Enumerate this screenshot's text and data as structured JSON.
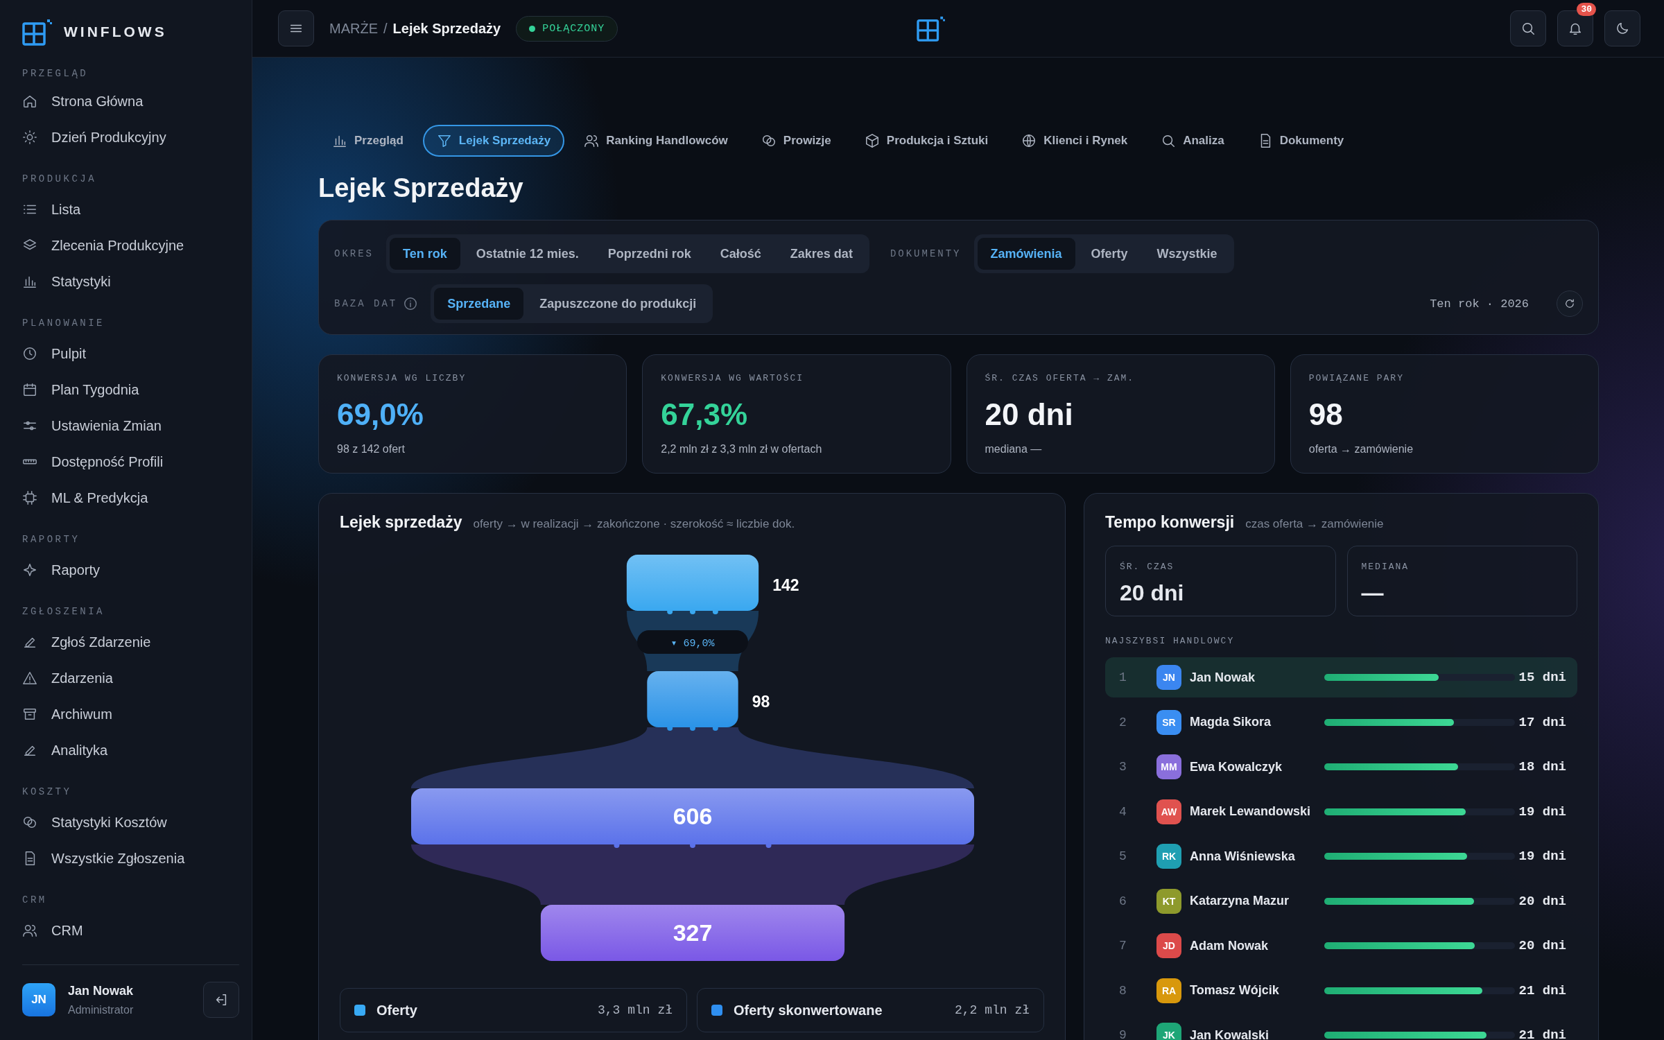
{
  "sidebar": {
    "brand": "WINFLOWS",
    "sections": [
      {
        "title": "PRZEGLĄD",
        "items": [
          "Strona Główna",
          "Dzień Produkcyjny"
        ]
      },
      {
        "title": "PRODUKCJA",
        "items": [
          "Lista",
          "Zlecenia Produkcyjne",
          "Statystyki"
        ]
      },
      {
        "title": "PLANOWANIE",
        "items": [
          "Pulpit",
          "Plan Tygodnia",
          "Ustawienia Zmian",
          "Dostępność Profili",
          "ML & Predykcja"
        ]
      },
      {
        "title": "RAPORTY",
        "items": [
          "Raporty"
        ]
      },
      {
        "title": "ZGŁOSZENIA",
        "items": [
          "Zgłoś Zdarzenie",
          "Zdarzenia",
          "Archiwum",
          "Analityka"
        ]
      },
      {
        "title": "KOSZTY",
        "items": [
          "Statystyki Kosztów",
          "Wszystkie Zgłoszenia"
        ]
      },
      {
        "title": "CRM",
        "items": [
          "CRM"
        ]
      }
    ],
    "user": {
      "initials": "JN",
      "name": "Jan Nowak",
      "role": "Administrator"
    }
  },
  "header": {
    "breadcrumb": [
      "MARŻE",
      "Lejek Sprzedaży"
    ],
    "separator": "/",
    "status": "POŁĄCZONY",
    "notifications": "30"
  },
  "tabs": [
    {
      "label": "Przegląd",
      "selected": false
    },
    {
      "label": "Lejek Sprzedaży",
      "selected": true
    },
    {
      "label": "Ranking Handlowców",
      "selected": false
    },
    {
      "label": "Prowizje",
      "selected": false
    },
    {
      "label": "Produkcja i Sztuki",
      "selected": false
    },
    {
      "label": "Klienci i Rynek",
      "selected": false
    },
    {
      "label": "Analiza",
      "selected": false
    },
    {
      "label": "Dokumenty",
      "selected": false
    }
  ],
  "page_title": "Lejek Sprzedaży",
  "filters": {
    "period": {
      "label": "OKRES",
      "options": [
        {
          "label": "Ten rok",
          "selected": true
        },
        {
          "label": "Ostatnie 12 mies.",
          "selected": false
        },
        {
          "label": "Poprzedni rok",
          "selected": false
        },
        {
          "label": "Całość",
          "selected": false
        },
        {
          "label": "Zakres dat",
          "selected": false
        }
      ]
    },
    "documents": {
      "label": "DOKUMENTY",
      "options": [
        {
          "label": "Zamówienia",
          "selected": true
        },
        {
          "label": "Oferty",
          "selected": false
        },
        {
          "label": "Wszystkie",
          "selected": false
        }
      ]
    },
    "base": {
      "label": "BAZA DAT",
      "options": [
        {
          "label": "Sprzedane",
          "selected": true
        },
        {
          "label": "Zapuszczone do produkcji",
          "selected": false
        }
      ]
    },
    "range": "Ten rok · 2026"
  },
  "kpis": [
    {
      "label": "KONWERSJA WG LICZBY",
      "value": "69,0%",
      "color": "#4fb0f7",
      "note": "98 z 142 ofert"
    },
    {
      "label": "KONWERSJA WG WARTOŚCI",
      "value": "67,3%",
      "color": "#34d399",
      "note": "2,2 mln zł z 3,3 mln zł w ofertach"
    },
    {
      "label": "ŚR. CZAS OFERTA → ZAM.",
      "value": "20 dni",
      "color": "#f3f5f8",
      "note": "mediana —"
    },
    {
      "label": "POWIĄZANE PARY",
      "value": "98",
      "color": "#f3f5f8",
      "note": "oferta → zamówienie"
    }
  ],
  "funnel": {
    "title": "Lejek sprzedaży",
    "subtitle": "oferty → w realizacji → zakończone · szerokość ≈ liczbie dok.",
    "stages": [
      {
        "value": "142",
        "color": "#3aa8f0"
      },
      {
        "value": "98",
        "color": "#2b93e8"
      },
      {
        "value": "606",
        "color": "#5b72ea"
      },
      {
        "value": "327",
        "color": "#7a58e6"
      }
    ],
    "conversion": "▾ 69,0%",
    "legend": [
      {
        "label": "Oferty",
        "value": "3,3 mln zł",
        "color": "#38aaf5"
      },
      {
        "label": "Oferty skonwertowane",
        "value": "2,2 mln zł",
        "color": "#2f8ff0"
      }
    ]
  },
  "tempo": {
    "title": "Tempo konwersji",
    "subtitle": "czas oferta → zamówienie",
    "stats": [
      {
        "label": "ŚR. CZAS",
        "value": "20 dni"
      },
      {
        "label": "MEDIANA",
        "value": "—"
      }
    ],
    "list_title": "NAJSZYBSI HANDLOWCY",
    "rows": [
      {
        "rank": "1",
        "initials": "JN",
        "color": "#3b86f0",
        "name": "Jan Nowak",
        "level": 0.6,
        "days": "15 dni",
        "selected": true
      },
      {
        "rank": "2",
        "initials": "SR",
        "color": "#3a8ef2",
        "name": "Magda Sikora",
        "level": 0.68,
        "days": "17 dni",
        "selected": false
      },
      {
        "rank": "3",
        "initials": "MM",
        "color": "#8a6fdc",
        "name": "Ewa Kowalczyk",
        "level": 0.7,
        "days": "18 dni",
        "selected": false
      },
      {
        "rank": "4",
        "initials": "AW",
        "color": "#e0524f",
        "name": "Marek Lewandowski",
        "level": 0.74,
        "days": "19 dni",
        "selected": false
      },
      {
        "rank": "5",
        "initials": "RK",
        "color": "#1f9fb2",
        "name": "Anna Wiśniewska",
        "level": 0.75,
        "days": "19 dni",
        "selected": false
      },
      {
        "rank": "6",
        "initials": "KT",
        "color": "#8e9a2c",
        "name": "Katarzyna Mazur",
        "level": 0.785,
        "days": "20 dni",
        "selected": false
      },
      {
        "rank": "7",
        "initials": "JD",
        "color": "#dc4a4a",
        "name": "Adam Nowak",
        "level": 0.79,
        "days": "20 dni",
        "selected": false
      },
      {
        "rank": "8",
        "initials": "RA",
        "color": "#d8980c",
        "name": "Tomasz Wójcik",
        "level": 0.83,
        "days": "21 dni",
        "selected": false
      },
      {
        "rank": "9",
        "initials": "JK",
        "color": "#1ea677",
        "name": "Jan Kowalski",
        "level": 0.85,
        "days": "21 dni",
        "selected": false
      }
    ]
  }
}
